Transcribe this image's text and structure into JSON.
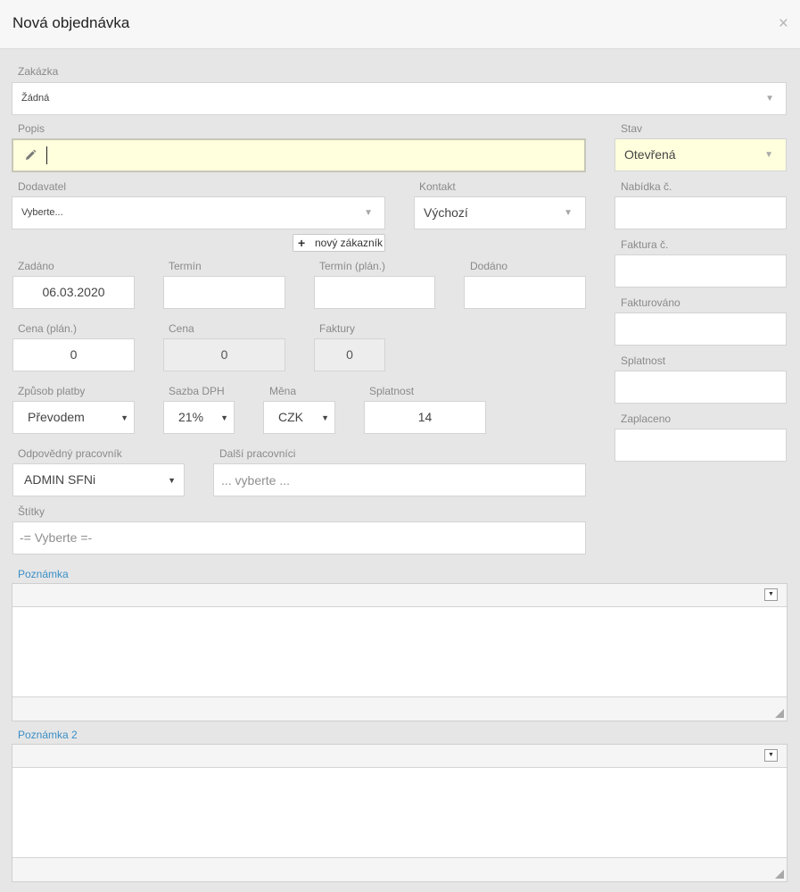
{
  "dialog": {
    "title": "Nová objednávka",
    "close_glyph": "×"
  },
  "zakazka": {
    "label": "Zakázka",
    "value": "Žádná"
  },
  "popis": {
    "label": "Popis",
    "value": ""
  },
  "stav": {
    "label": "Stav",
    "value": "Otevřená"
  },
  "dodavatel": {
    "label": "Dodavatel",
    "placeholder": "Vyberte..."
  },
  "kontakt": {
    "label": "Kontakt",
    "value": "Výchozí"
  },
  "new_customer": {
    "label": "nový zákazník",
    "icon": "plus-icon"
  },
  "nabidka": {
    "label": "Nabídka č.",
    "value": ""
  },
  "faktura": {
    "label": "Faktura č.",
    "value": ""
  },
  "fakturovano": {
    "label": "Fakturováno",
    "value": ""
  },
  "splatnost_right": {
    "label": "Splatnost",
    "value": ""
  },
  "zaplaceno": {
    "label": "Zaplaceno",
    "value": ""
  },
  "zadano": {
    "label": "Zadáno",
    "value": "06.03.2020"
  },
  "termin": {
    "label": "Termín",
    "value": ""
  },
  "termin_plan": {
    "label": "Termín (plán.)",
    "value": ""
  },
  "dodano": {
    "label": "Dodáno",
    "value": ""
  },
  "cena_plan": {
    "label": "Cena (plán.)",
    "value": "0"
  },
  "cena": {
    "label": "Cena",
    "value": "0"
  },
  "faktury": {
    "label": "Faktury",
    "value": "0"
  },
  "zpusob_platby": {
    "label": "Způsob platby",
    "value": "Převodem"
  },
  "sazba_dph": {
    "label": "Sazba DPH",
    "value": "21%"
  },
  "mena": {
    "label": "Měna",
    "value": "CZK"
  },
  "splatnost": {
    "label": "Splatnost",
    "value": "14"
  },
  "odpovedny": {
    "label": "Odpovědný pracovník",
    "value": "ADMIN SFNi"
  },
  "dalsi": {
    "label": "Další pracovníci",
    "placeholder": "... vyberte ..."
  },
  "stitky": {
    "label": "Štítky",
    "placeholder": "-= Vyberte =-"
  },
  "poznamka": {
    "label": "Poznámka"
  },
  "poznamka2": {
    "label": "Poznámka 2"
  },
  "colors": {
    "accent_blue": "#3a8fc7",
    "highlight_yellow": "#ffffdd",
    "background": "#e6e6e6"
  }
}
